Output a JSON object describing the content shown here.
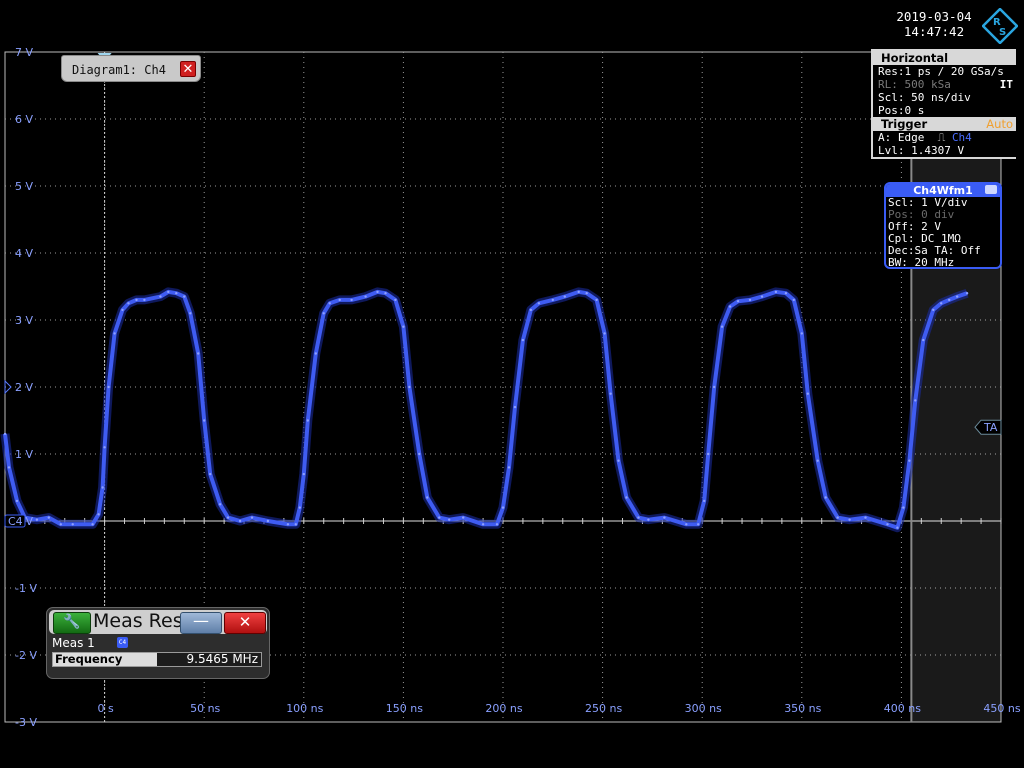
{
  "header": {
    "date": "2019-03-04",
    "time": "14:47:42",
    "logo": "rohde-schwarz-logo"
  },
  "diagram_tab": {
    "label": "Diagram1: Ch4"
  },
  "horizontal_panel": {
    "title": "Horizontal",
    "res": "Res:1 ps / 20 GSa/s",
    "rl": "RL: 500 kSa",
    "it": "IT",
    "scl": "Scl: 50 ns/div",
    "pos": "Pos:0 s",
    "trigger_title": "Trigger",
    "trigger_mode": "Auto",
    "trigger_type": "A:  Edge",
    "trigger_source": "Ch4",
    "level": "Lvl: 1.4307 V"
  },
  "channel_panel": {
    "title": "Ch4Wfm1",
    "scl": "Scl: 1 V/div",
    "pos": "Pos: 0 div",
    "off": "Off: 2 V",
    "cpl": "Cpl: DC 1MΩ",
    "dec": "Dec:Sa    TA: Off",
    "bw": "BW: 20 MHz"
  },
  "meas_window": {
    "title": "Meas Res",
    "minimize": "—",
    "close": "✕",
    "name": "Meas 1",
    "channel_badge": "C4",
    "param": "Frequency",
    "value": "9.5465 MHz"
  },
  "markers": {
    "ground": "C4",
    "trigger_arrow": "TA"
  },
  "colors": {
    "trace": "#3f5cf2",
    "axis_label": "#8aa0ff",
    "grid": "#a0a0a0",
    "accent": "#3a5cf5"
  },
  "chart_data": {
    "type": "line",
    "y_ticks": [
      "7 V",
      "6 V",
      "5 V",
      "4 V",
      "3 V",
      "2 V",
      "1 V",
      "0 V",
      "-1 V",
      "-2 V",
      "-3 V"
    ],
    "x_ticks": [
      "0 s",
      "50 ns",
      "100 ns",
      "150 ns",
      "200 ns",
      "250 ns",
      "300 ns",
      "350 ns",
      "400 ns",
      "450 ns"
    ],
    "xlim": [
      -50,
      450
    ],
    "ylim": [
      -3,
      7
    ],
    "grid": true,
    "series": [
      {
        "x": [
          -50,
          -48,
          -44,
          -40,
          -34,
          -28,
          -22,
          -16,
          -6,
          -3,
          -1,
          0,
          2,
          5,
          9,
          12,
          16,
          20,
          28,
          32,
          36,
          40,
          43,
          47,
          50,
          53,
          58,
          62,
          68,
          74,
          82,
          92,
          96,
          98,
          100,
          102,
          106,
          110,
          113,
          118,
          124,
          131,
          137,
          141,
          146,
          150,
          153,
          158,
          162,
          168,
          173,
          180,
          190,
          197,
          200,
          203,
          206,
          210,
          214,
          218,
          225,
          231,
          238,
          242,
          247,
          251,
          254,
          258,
          262,
          268,
          273,
          281,
          292,
          298,
          301,
          303,
          306,
          310,
          314,
          318,
          324,
          330,
          337,
          342,
          346,
          350,
          353,
          358,
          362,
          368,
          374,
          382,
          393,
          398,
          401,
          404,
          407,
          411,
          416,
          420,
          424,
          428,
          433
        ],
        "y": [
          1.3,
          0.8,
          0.3,
          0.05,
          0.02,
          0.05,
          -0.05,
          -0.05,
          -0.05,
          0.1,
          0.5,
          1.1,
          2.0,
          2.8,
          3.15,
          3.25,
          3.3,
          3.3,
          3.35,
          3.42,
          3.4,
          3.35,
          3.1,
          2.5,
          1.5,
          0.7,
          0.25,
          0.05,
          0.0,
          0.05,
          0.0,
          -0.05,
          -0.05,
          0.2,
          0.7,
          1.5,
          2.5,
          3.1,
          3.25,
          3.3,
          3.3,
          3.35,
          3.42,
          3.4,
          3.3,
          2.9,
          2.0,
          1.0,
          0.35,
          0.05,
          0.02,
          0.05,
          -0.05,
          -0.05,
          0.2,
          0.8,
          1.7,
          2.7,
          3.15,
          3.25,
          3.3,
          3.35,
          3.42,
          3.4,
          3.3,
          2.8,
          1.9,
          0.9,
          0.35,
          0.05,
          0.02,
          0.05,
          -0.05,
          -0.05,
          0.3,
          1.0,
          2.0,
          2.9,
          3.2,
          3.28,
          3.3,
          3.35,
          3.42,
          3.4,
          3.3,
          2.8,
          1.9,
          0.9,
          0.35,
          0.05,
          0.02,
          0.05,
          -0.05,
          -0.1,
          0.2,
          0.9,
          1.8,
          2.7,
          3.15,
          3.25,
          3.3,
          3.35,
          3.4
        ]
      }
    ]
  }
}
